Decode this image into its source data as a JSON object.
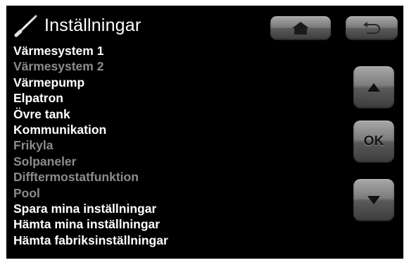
{
  "header": {
    "title": "Inställningar",
    "icon": "wrench-icon"
  },
  "menu": {
    "items": [
      {
        "label": "Värmesystem 1",
        "enabled": true
      },
      {
        "label": "Värmesystem 2",
        "enabled": false
      },
      {
        "label": "Värmepump",
        "enabled": true
      },
      {
        "label": "Elpatron",
        "enabled": true
      },
      {
        "label": "Övre tank",
        "enabled": true
      },
      {
        "label": "Kommunikation",
        "enabled": true
      },
      {
        "label": "Frikyla",
        "enabled": false
      },
      {
        "label": "Solpaneler",
        "enabled": false
      },
      {
        "label": "Difftermostatfunktion",
        "enabled": false
      },
      {
        "label": "Pool",
        "enabled": false
      },
      {
        "label": "Spara mina inställningar",
        "enabled": true
      },
      {
        "label": "Hämta mina inställningar",
        "enabled": true
      },
      {
        "label": "Hämta fabriksinställningar",
        "enabled": true
      }
    ]
  },
  "buttons": {
    "home": {
      "icon": "home-icon"
    },
    "back": {
      "icon": "back-arrow-icon"
    },
    "up": {
      "icon": "arrow-up-icon"
    },
    "ok": {
      "label": "OK"
    },
    "down": {
      "icon": "arrow-down-icon"
    }
  },
  "colors": {
    "background": "#000000",
    "enabled_text": "#ffffff",
    "disabled_text": "#8c8c8c",
    "button_gray": "#7c7c7c"
  }
}
